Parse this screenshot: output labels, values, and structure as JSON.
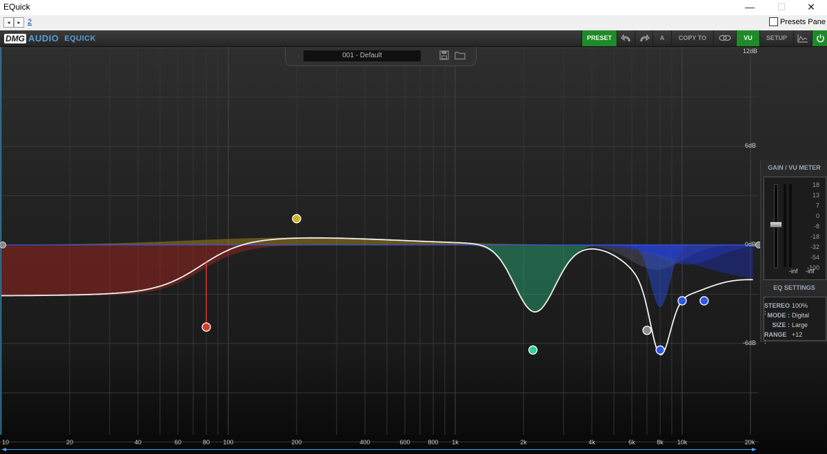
{
  "window": {
    "title": "EQuick",
    "minimize": "—",
    "maximize": "☐",
    "close": "✕"
  },
  "host": {
    "back": "◂",
    "forward": "▸",
    "link": "2",
    "presets_pane": "Presets Pane"
  },
  "toolbar": {
    "logo_dmg": "DMG",
    "logo_audio": "AUDIO",
    "product": "EQUICK",
    "preset_label": "PRESET",
    "undo_icon": "undo-icon",
    "redo_icon": "redo-icon",
    "ab_label": "A",
    "copy_to_label": "COPY TO",
    "link_icon": "link-icon",
    "vu_label": "VU",
    "setup_label": "SETUP",
    "analyzer_icon": "analyzer-icon",
    "power_icon": "power-icon",
    "accent": "#1f8a2a"
  },
  "preset_panel": {
    "name": "001 - Default",
    "save_icon": "save-icon",
    "folder_icon": "folder-icon"
  },
  "db_labels": [
    "12dB",
    "6dB",
    "0dB",
    "-6dB"
  ],
  "freq_labels": [
    "10",
    "20",
    "40",
    "60",
    "80",
    "100",
    "200",
    "400",
    "600",
    "800",
    "1k",
    "2k",
    "4k",
    "6k",
    "8k",
    "10k",
    "20k"
  ],
  "bands": [
    {
      "color": "#d93a2a",
      "freq": 80,
      "gain_db": -5
    },
    {
      "color": "#d4b21a",
      "freq": 200,
      "gain_db": 1.6
    },
    {
      "color": "#2fcf9a",
      "freq": 2200,
      "gain_db": -6.4
    },
    {
      "color": "#8c8c8c",
      "freq": 7000,
      "gain_db": -5.2
    },
    {
      "color": "#2c58e8",
      "freq": 8000,
      "gain_db": -6.4
    },
    {
      "color": "#2c58e8",
      "freq": 10000,
      "gain_db": -3.4
    },
    {
      "color": "#2c58e8",
      "freq": 12500,
      "gain_db": -3.4
    }
  ],
  "gain_panel": {
    "title": "GAIN / VU METER",
    "scale": [
      "18",
      "13",
      "7",
      "0",
      "-8",
      "-18",
      "-32",
      "-54",
      "-100"
    ],
    "in_level": "-inf",
    "out_level": "-inf"
  },
  "eq_settings": {
    "title": "EQ SETTINGS",
    "rows": [
      {
        "key": "STEREO :",
        "value": "100%"
      },
      {
        "key": "MODE :",
        "value": "Digital"
      },
      {
        "key": "SIZE :",
        "value": "Large"
      },
      {
        "key": "RANGE :",
        "value": "+12"
      }
    ]
  },
  "scrollbar": {
    "left_arrow": "◄",
    "right_arrow": "►"
  }
}
